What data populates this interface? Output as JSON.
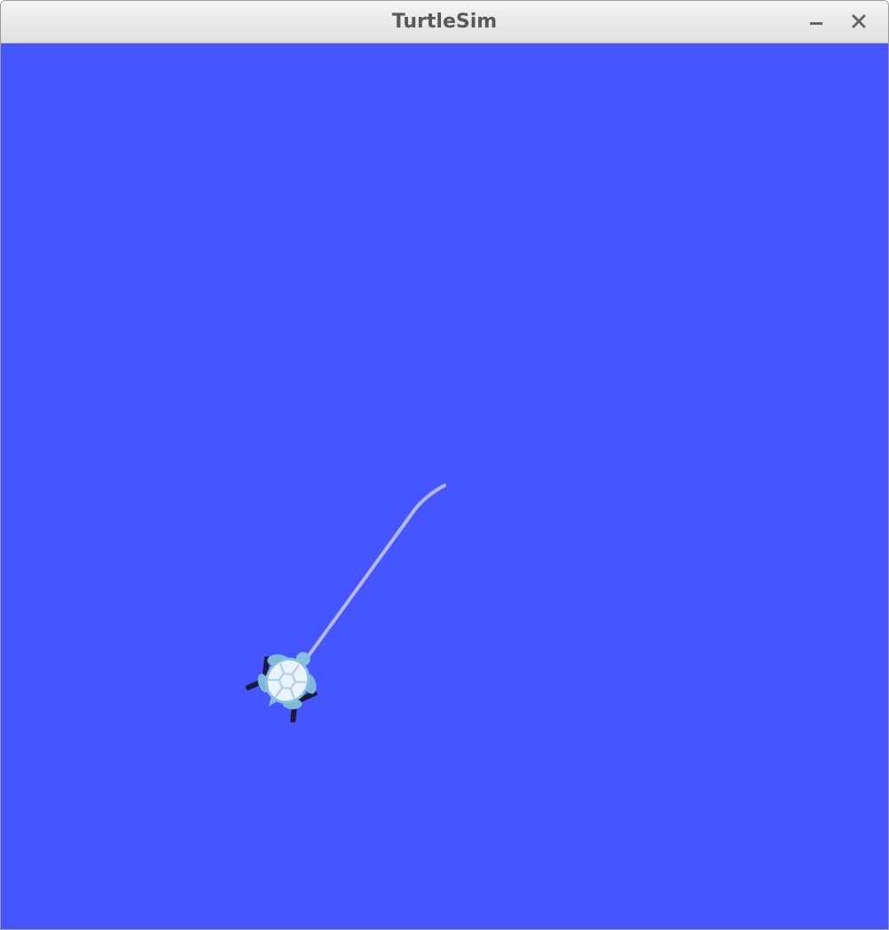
{
  "window": {
    "title": "TurtleSim",
    "minimize_icon": "minimize-icon",
    "close_icon": "close-icon"
  },
  "canvas": {
    "background_color": "#4556ff",
    "trail_color": "#b3b9ff",
    "turtle_icon": "turtle-icon"
  }
}
